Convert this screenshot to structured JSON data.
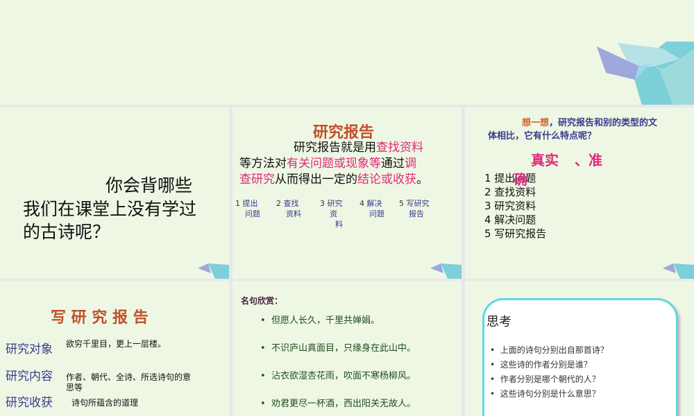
{
  "slide1": {
    "line1": "你会背哪些",
    "line2": "我们在课堂上没有学过",
    "line3": "的古诗呢？"
  },
  "slide2": {
    "title": "研究报告",
    "p1a": "研究报告就是用",
    "p1b": "查找资料",
    "p2a": "等方法对",
    "p2b": "有关问题或现象等",
    "p2c": "通过",
    "p2d": "调",
    "p3a": "查研究",
    "p3b": "从而得出一定的",
    "p3c": "结论或收获",
    "p3d": "。",
    "steps": [
      {
        "num": "1",
        "a": "提出",
        "b": "问题"
      },
      {
        "num": "2",
        "a": "查找",
        "b": "资料"
      },
      {
        "num": "3",
        "a": "研究",
        "b": "资",
        "c": "料"
      },
      {
        "num": "4",
        "a": "解决",
        "b": "问题"
      },
      {
        "num": "5",
        "a": "写研究",
        "b": "报告"
      }
    ]
  },
  "slide3": {
    "q_hl": "想一想",
    "q_rest": "，研究报告和别的类型的文",
    "q_line2": "体相比，它有什么特点呢？",
    "feature1": "真实",
    "feature2": "、准",
    "feature3": "确",
    "list": [
      "1 提出问题",
      "2 查找资料",
      "3 研究资料",
      "4 解决问题",
      "5 写研究报告"
    ]
  },
  "slide4": {
    "title": "写 研 究 报 告",
    "rows": [
      {
        "label": "研究对象",
        "value": "欲穷千里目，更上一层楼。"
      },
      {
        "label": "研究内容",
        "value": "作者、朝代、全诗、所选诗句的意",
        "value2": "思等"
      },
      {
        "label": "研究收获",
        "value": "诗句所蕴含的道理"
      }
    ]
  },
  "slide5": {
    "heading": "名句欣赏：",
    "lines": [
      "但愿人长久，千里共婵娟。",
      "不识庐山真面目，只缘身在此山中。",
      "沾衣欲湿杏花雨，吹面不寒杨柳风。",
      "劝君更尽一杯酒，西出阳关无故人。"
    ]
  },
  "slide6": {
    "heading": "思考",
    "items": [
      "上面的诗句分别出自那首诗？",
      "这些诗的作者分别是谁？",
      "作者分别是哪个朝代的人？",
      "这些诗句分别是什么意思？"
    ]
  },
  "colors": {
    "bg": "#eef7e4",
    "title": "#c0502b",
    "pink": "#e0287a",
    "blue": "#3a3a8c",
    "green": "#1f4d1f",
    "frame": "#5ed8e0"
  }
}
